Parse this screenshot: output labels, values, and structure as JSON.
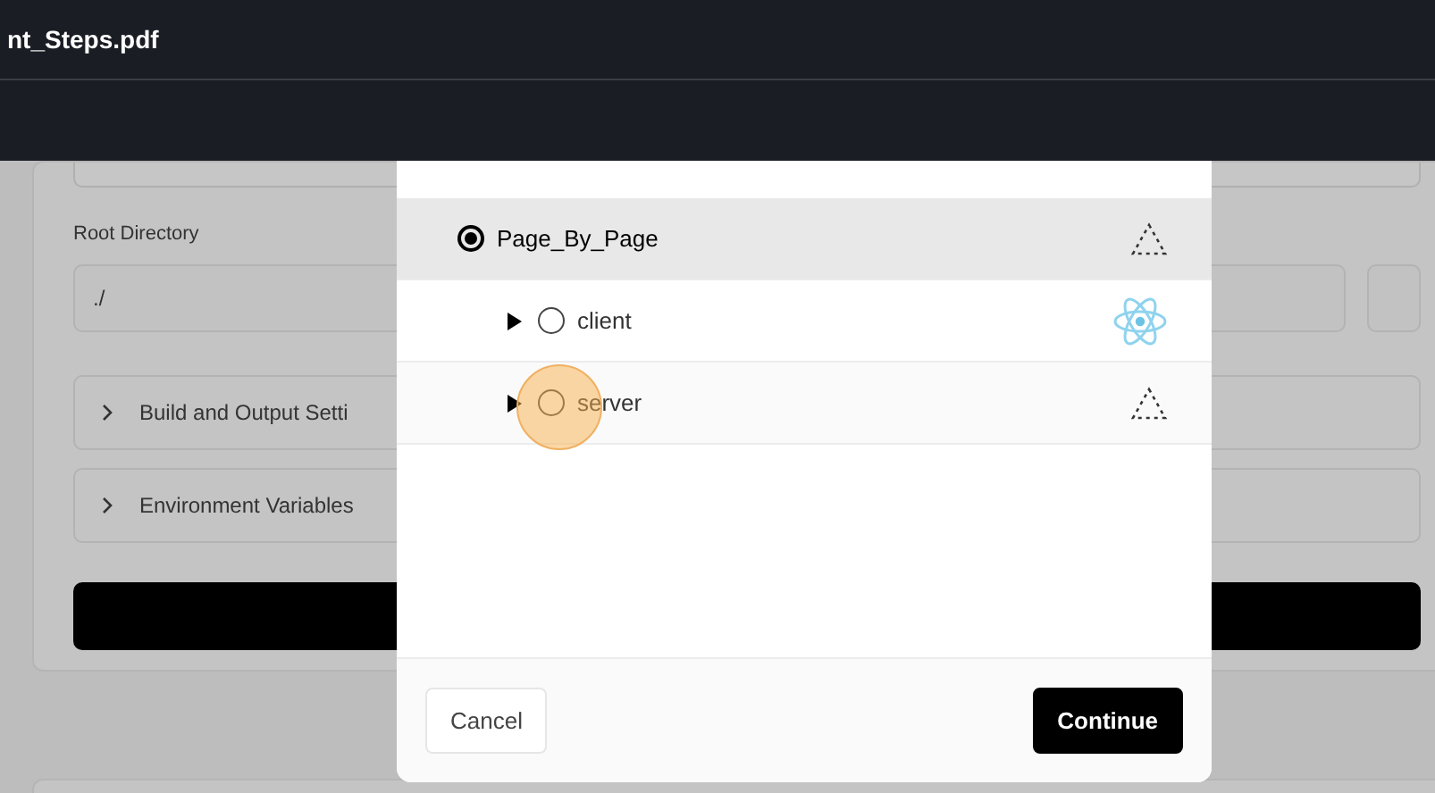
{
  "window": {
    "title": "nt_Steps.pdf"
  },
  "form": {
    "root_directory": {
      "label": "Root Directory",
      "value": "./"
    },
    "sections": [
      {
        "label": "Build and Output Setti",
        "expanded": false
      },
      {
        "label": "Environment Variables",
        "expanded": false
      }
    ]
  },
  "dialog": {
    "tree": [
      {
        "label": "Page_By_Page",
        "selected": true,
        "kind": "other",
        "children": [
          {
            "label": "client",
            "selected": false,
            "kind": "react",
            "expanded": false
          },
          {
            "label": "server",
            "selected": false,
            "kind": "other",
            "expanded": false
          }
        ]
      }
    ],
    "buttons": [
      {
        "label": "Cancel",
        "kind": "secondary"
      },
      {
        "label": "Continue",
        "kind": "primary"
      }
    ]
  }
}
